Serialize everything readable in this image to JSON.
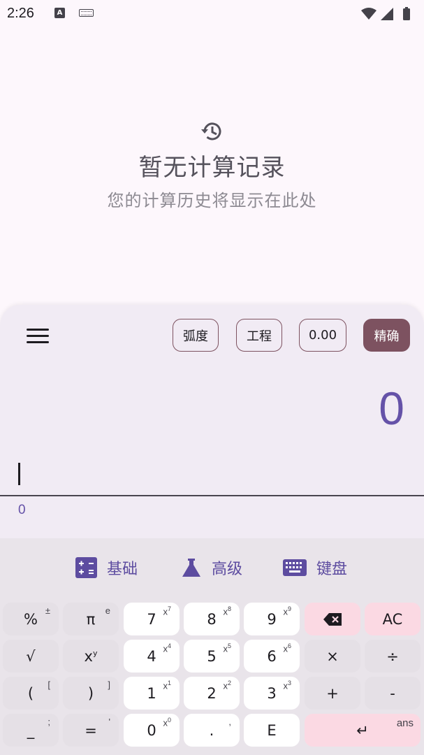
{
  "status_bar": {
    "time": "2:26",
    "a_icon_letter": "A"
  },
  "history": {
    "title": "暂无计算记录",
    "subtitle": "您的计算历史将显示在此处"
  },
  "toolbar": {
    "chips": [
      "弧度",
      "工程",
      "0.00",
      "精确"
    ]
  },
  "display": {
    "result": "0",
    "preview": "0"
  },
  "tabs": [
    "基础",
    "高级",
    "键盘"
  ],
  "keys": {
    "r1": [
      {
        "main": "%",
        "sup": "±"
      },
      {
        "main": "π",
        "sup": "e"
      },
      {
        "main": "7",
        "sup": "x",
        "sup_exp": "7"
      },
      {
        "main": "8",
        "sup": "x",
        "sup_exp": "8"
      },
      {
        "main": "9",
        "sup": "x",
        "sup_exp": "9"
      },
      {
        "main": "⌫",
        "sup": ""
      },
      {
        "main": "AC",
        "sup": ""
      }
    ],
    "r2": [
      {
        "main": "√",
        "sup": ""
      },
      {
        "main": "x",
        "main_exp": "y",
        "sup": ""
      },
      {
        "main": "4",
        "sup": "x",
        "sup_exp": "4"
      },
      {
        "main": "5",
        "sup": "x",
        "sup_exp": "5"
      },
      {
        "main": "6",
        "sup": "x",
        "sup_exp": "6"
      },
      {
        "main": "×",
        "sup": ""
      },
      {
        "main": "÷",
        "sup": ""
      }
    ],
    "r3": [
      {
        "main": "(",
        "sup": "["
      },
      {
        "main": ")",
        "sup": "]"
      },
      {
        "main": "1",
        "sup": "x",
        "sup_exp": "1"
      },
      {
        "main": "2",
        "sup": "x",
        "sup_exp": "2"
      },
      {
        "main": "3",
        "sup": "x",
        "sup_exp": "3"
      },
      {
        "main": "+",
        "sup": ""
      },
      {
        "main": "-",
        "sup": ""
      }
    ],
    "r4": [
      {
        "main": "_",
        "sup": ";"
      },
      {
        "main": "=",
        "sup": "'"
      },
      {
        "main": "0",
        "sup": "x",
        "sup_exp": "0"
      },
      {
        "main": ".",
        "sup": ","
      },
      {
        "main": "E",
        "sup": ""
      },
      {
        "main": "↵",
        "sup": "ans"
      }
    ]
  },
  "colors": {
    "accent": "#6552a8",
    "chip_border": "#7d5260",
    "key_pink": "#fbd9e3"
  }
}
